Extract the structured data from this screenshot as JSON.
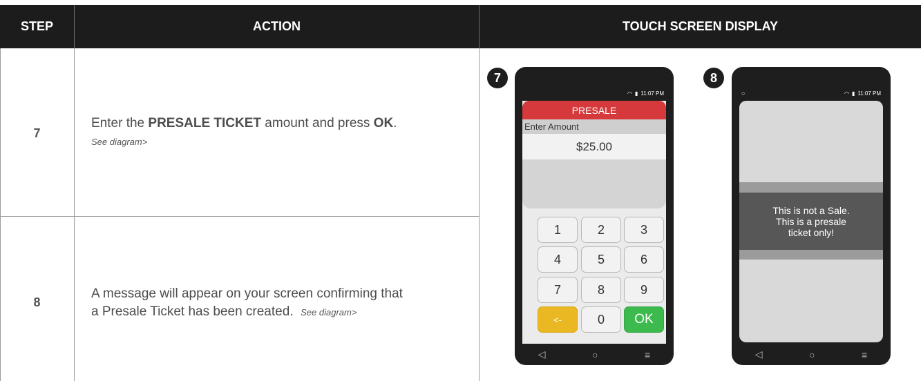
{
  "headers": {
    "step": "STEP",
    "action": "ACTION",
    "display": "TOUCH SCREEN DISPLAY"
  },
  "rows": [
    {
      "step": "7",
      "action_parts": [
        "Enter the ",
        "PRESALE TICKET",
        " amount and press ",
        "OK",
        "."
      ],
      "see": "See diagram>"
    },
    {
      "step": "8",
      "action_line1": "A message will appear on your screen confirming that",
      "action_line2": "a Presale Ticket has been created.",
      "see": "See diagram>"
    }
  ],
  "phone7": {
    "badge": "7",
    "time": "11:07 PM",
    "title": "PRESALE",
    "amount_label": "Enter Amount",
    "amount_value": "$25.00",
    "keys": [
      "1",
      "2",
      "3",
      "4",
      "5",
      "6",
      "7",
      "8",
      "9",
      "<-",
      "0",
      "OK"
    ]
  },
  "phone8": {
    "badge": "8",
    "time": "11:07 PM",
    "message_line1": "This is not a Sale.",
    "message_line2": "This is a presale",
    "message_line3": "ticket only!"
  },
  "nav_icons": [
    "back-icon",
    "home-icon",
    "menu-icon"
  ],
  "colors": {
    "header_bg": "#1c1c1c",
    "presale_red": "#d6393b",
    "ok_green": "#3dba4e",
    "back_yellow": "#e9b822"
  }
}
